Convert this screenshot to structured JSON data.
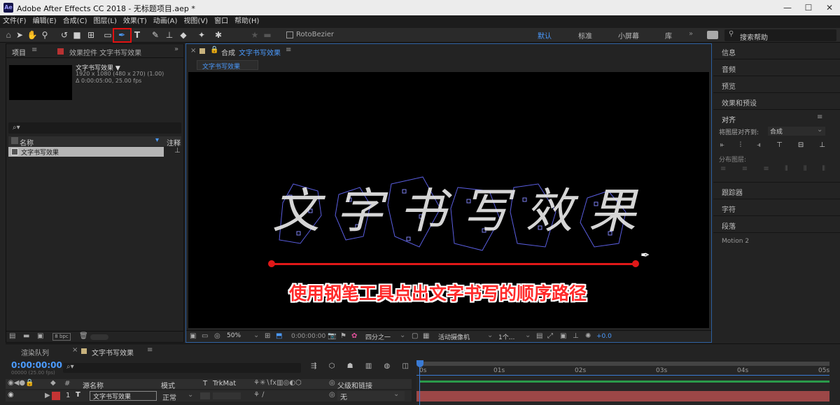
{
  "window": {
    "title": "Adobe After Effects CC 2018 - 无标题项目.aep *",
    "app_icon": "Ae"
  },
  "menu": [
    "文件(F)",
    "编辑(E)",
    "合成(C)",
    "图层(L)",
    "效果(T)",
    "动画(A)",
    "视图(V)",
    "窗口",
    "帮助(H)"
  ],
  "toolbar": {
    "rotobezier": "RotoBezier",
    "workspaces": [
      "默认",
      "标准",
      "小屏幕",
      "库"
    ],
    "search_placeholder": "搜索帮助",
    "active_workspace_color": "#4b9bff"
  },
  "project_panel": {
    "tab_project": "项目",
    "tab_effects": "效果控件 文字书写效果",
    "comp_name": "文字书写效果 ▼",
    "comp_res": "1920 x 1080  (480 x 270) (1.00)",
    "comp_dur": "Δ 0:00:05:00, 25.00 fps",
    "search_icon": "⌕▾",
    "col_name": "名称",
    "col_comment": "注释",
    "item": "文字书写效果",
    "bpc": "8 bpc"
  },
  "comp_panel": {
    "lock_label": "合成",
    "comp_title": "文字书写效果",
    "breadcrumb": "文字书写效果",
    "caption": "使用钢笔工具点出文字书写的顺序路径",
    "art_text": [
      "文",
      "字",
      "书",
      "写",
      "效",
      "果"
    ],
    "zoom": "50%",
    "timecode": "0:00:00:00",
    "quality": "四分之一",
    "camera": "活动摄像机",
    "views": "1个...",
    "exposure": "+0.0"
  },
  "right_panels": {
    "items_top": [
      "信息",
      "音频",
      "预览",
      "效果和预设"
    ],
    "align_title": "对齐",
    "align_to_label": "将图层对齐到:",
    "align_to_value": "合成",
    "distribute_label": "分布图层:",
    "items_bottom": [
      "跟踪器",
      "字符",
      "段落",
      "Motion 2"
    ]
  },
  "timeline": {
    "tab_render": "渲染队列",
    "tab_comp": "文字书写效果",
    "timecode": "0:00:00:00",
    "fps": "00000 (25.00 fps)",
    "search_icon": "⌕▾",
    "col_source": "源名称",
    "col_mode": "模式",
    "col_t": "T",
    "col_trkmat": "TrkMat",
    "col_parent": "父级和链接",
    "layer_index": "1",
    "layer_type": "T",
    "layer_name": "文字书写效果",
    "layer_mode": "正常",
    "layer_parent": "无",
    "ruler": [
      "0s",
      "01s",
      "02s",
      "03s",
      "04s",
      "05s"
    ]
  }
}
